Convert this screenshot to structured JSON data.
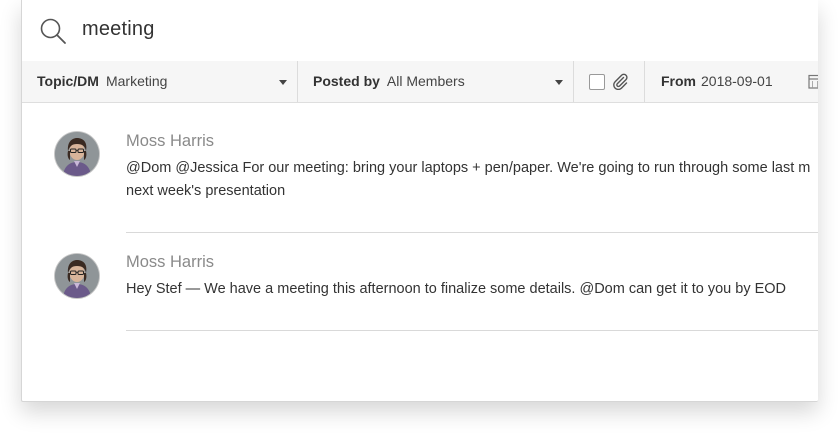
{
  "search": {
    "query": "meeting",
    "icon": "search-icon"
  },
  "filters": {
    "topic": {
      "label": "Topic/DM",
      "value": "Marketing"
    },
    "posted_by": {
      "label": "Posted by",
      "value": "All Members"
    },
    "attachments": {
      "checked": false,
      "icon": "paperclip-icon"
    },
    "from": {
      "label": "From",
      "value": "2018-09-01",
      "icon": "calendar-icon"
    }
  },
  "results": [
    {
      "author": "Moss Harris",
      "line1": "@Dom @Jessica For our meeting: bring your laptops + pen/paper. We're going to run through some last m",
      "line2": "next week's presentation"
    },
    {
      "author": "Moss Harris",
      "line1": "Hey Stef — We have a meeting this afternoon to finalize some details. @Dom can get it to you by EOD"
    }
  ],
  "colors": {
    "filter_bg": "#f6f6f6",
    "author": "#8a8a8a",
    "text": "#333333",
    "divider": "#d9d9d9"
  }
}
